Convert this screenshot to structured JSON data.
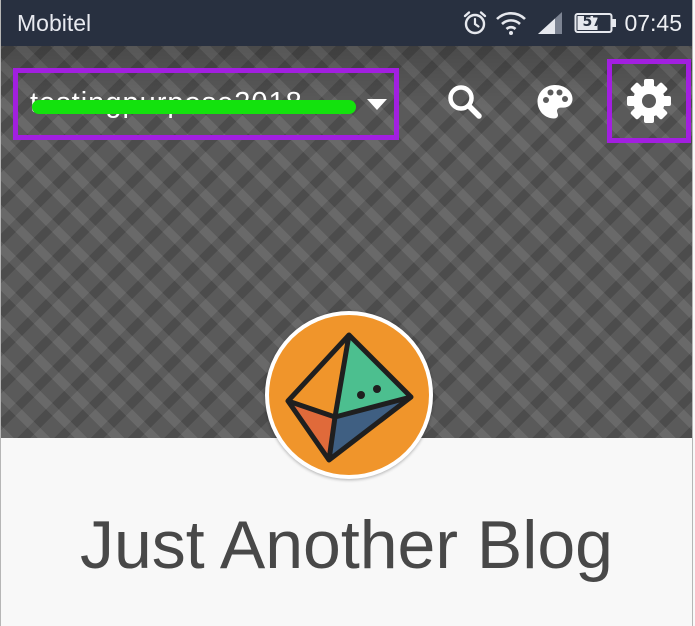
{
  "status_bar": {
    "carrier": "Mobitel",
    "battery_level": "57",
    "time": "07:45",
    "icons": [
      "alarm-icon",
      "wifi-icon",
      "signal-icon",
      "battery-icon"
    ]
  },
  "toolbar": {
    "site_name": "testingpurpose2018",
    "icons": [
      "chevron-down-icon",
      "search-icon",
      "palette-icon",
      "gear-icon"
    ]
  },
  "blog": {
    "title": "Just Another Blog"
  },
  "colors": {
    "status_bar": "#283040",
    "highlight": "#a21fe0",
    "redaction": "#13e20d",
    "avatar_orange": "#f0952b",
    "title_text": "#484848"
  }
}
